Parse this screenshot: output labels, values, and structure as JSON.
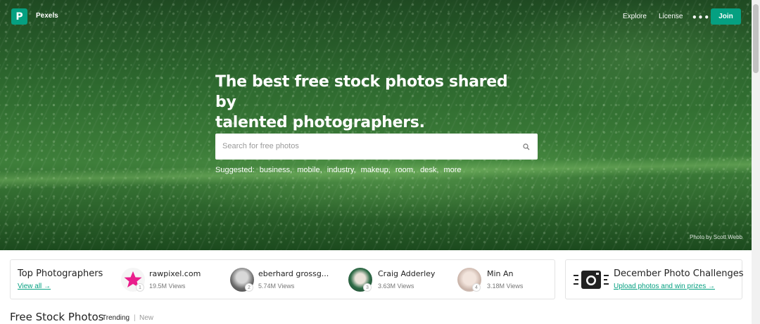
{
  "header": {
    "logo_letter": "P",
    "brand": "Pexels",
    "nav": [
      "Explore",
      "License"
    ],
    "more": "•••",
    "join": "Join"
  },
  "hero": {
    "headline_line1": "The best free stock photos shared by",
    "headline_line2": "talented photographers.",
    "search_placeholder": "Search for free photos",
    "suggested_label": "Suggested:",
    "suggestions": [
      "business,",
      "mobile,",
      "industry,",
      "makeup,",
      "room,",
      "desk,",
      "more"
    ],
    "photo_credit": "Photo by Scott Webb"
  },
  "top_photographers": {
    "title": "Top Photographers",
    "view_all": "View all →",
    "people": [
      {
        "rank": "1",
        "name": "rawpixel.com",
        "views": "19.5M Views",
        "avatar": "pink-star"
      },
      {
        "rank": "2",
        "name": "eberhard grossg...",
        "views": "5.74M Views",
        "avatar": "gray-portrait"
      },
      {
        "rank": "3",
        "name": "Craig Adderley",
        "views": "3.63M Views",
        "avatar": "green-portrait"
      },
      {
        "rank": "4",
        "name": "Min An",
        "views": "3.18M Views",
        "avatar": "light-portrait"
      }
    ]
  },
  "challenges": {
    "title": "December Photo Challenges",
    "link": "Upload photos and win prizes →"
  },
  "feed": {
    "title": "Free Stock Photos",
    "tab_trending": "Trending",
    "separator": "|",
    "tab_new": "New"
  },
  "colors": {
    "accent": "#05a081"
  }
}
